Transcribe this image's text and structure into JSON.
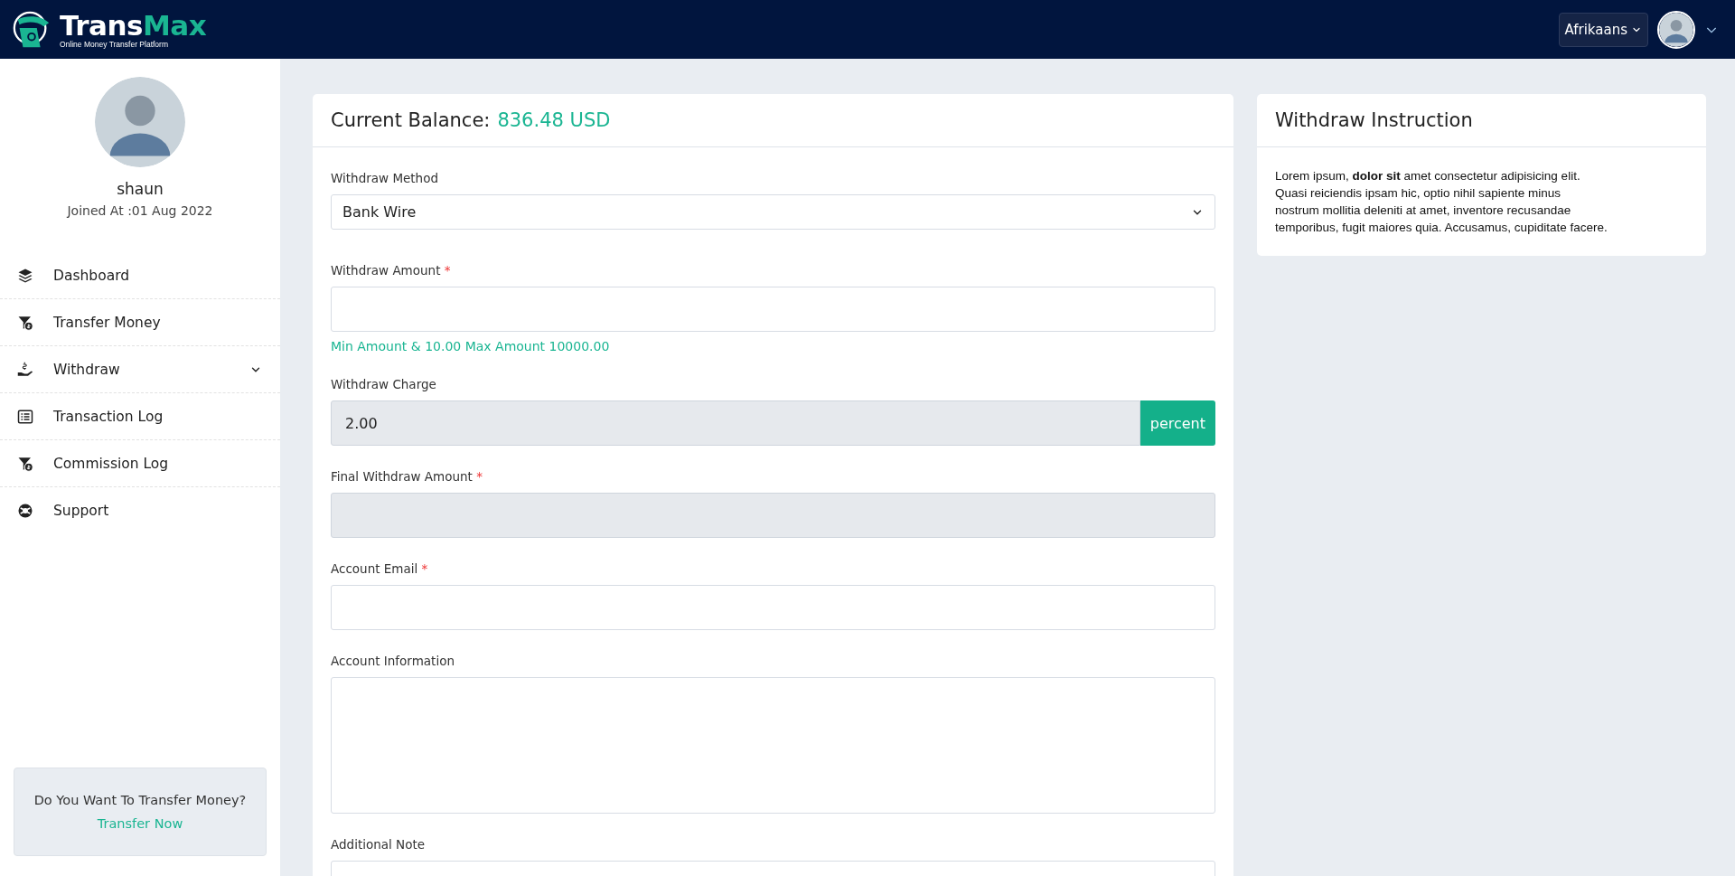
{
  "header": {
    "brand": "Trans",
    "brand_accent": "Max",
    "tagline": "Online Money Transfer Platform",
    "language": "Afrikaans"
  },
  "sidebar": {
    "user": {
      "name": "shaun",
      "joined": "Joined At :01 Aug 2022"
    },
    "menu": [
      {
        "label": "Dashboard",
        "kind": "layers",
        "expandable": false
      },
      {
        "label": "Transfer Money",
        "kind": "funnel-coin",
        "expandable": false
      },
      {
        "label": "Withdraw",
        "kind": "hand-coin",
        "expandable": true
      },
      {
        "label": "Transaction Log",
        "kind": "list",
        "expandable": false
      },
      {
        "label": "Commission Log",
        "kind": "funnel-coin",
        "expandable": false
      },
      {
        "label": "Support",
        "kind": "lifebuoy",
        "expandable": false
      }
    ],
    "promo": {
      "text": "Do You Want To Transfer Money?",
      "link": "Transfer Now"
    }
  },
  "balance": {
    "label": "Current Balance:",
    "amount": "836.48 USD"
  },
  "form": {
    "required_mark": "*",
    "fields": [
      {
        "kind": "select",
        "label": "Withdraw Method",
        "required": false,
        "value": "Bank Wire",
        "readonly": false
      },
      {
        "kind": "input",
        "label": "Withdraw Amount",
        "required": true,
        "readonly": false,
        "hint": "Min Amount & 10.00 Max Amount 10000.00"
      },
      {
        "kind": "input",
        "label": "Withdraw Charge",
        "required": false,
        "value": "2.00",
        "readonly": true,
        "addon": "percent"
      },
      {
        "kind": "input",
        "label": "Final Withdraw Amount",
        "required": true,
        "readonly": true
      },
      {
        "kind": "input",
        "label": "Account Email",
        "required": true,
        "readonly": false
      },
      {
        "kind": "textarea",
        "label": "Account Information",
        "required": false,
        "readonly": false
      },
      {
        "kind": "input",
        "label": "Additional Note",
        "required": false,
        "readonly": false
      }
    ]
  },
  "instruction": {
    "title": "Withdraw Instruction",
    "lines": [
      "Lorem ipsum, **dolor sit** amet consectetur adipisicing elit.",
      "Quasi reiciendis ipsam hic, optio nihil sapiente minus",
      "nostrum mollitia deleniti at amet, inventore recusandae",
      "temporibus, fugit maiores quia. Accusamus, cupiditate facere."
    ]
  }
}
